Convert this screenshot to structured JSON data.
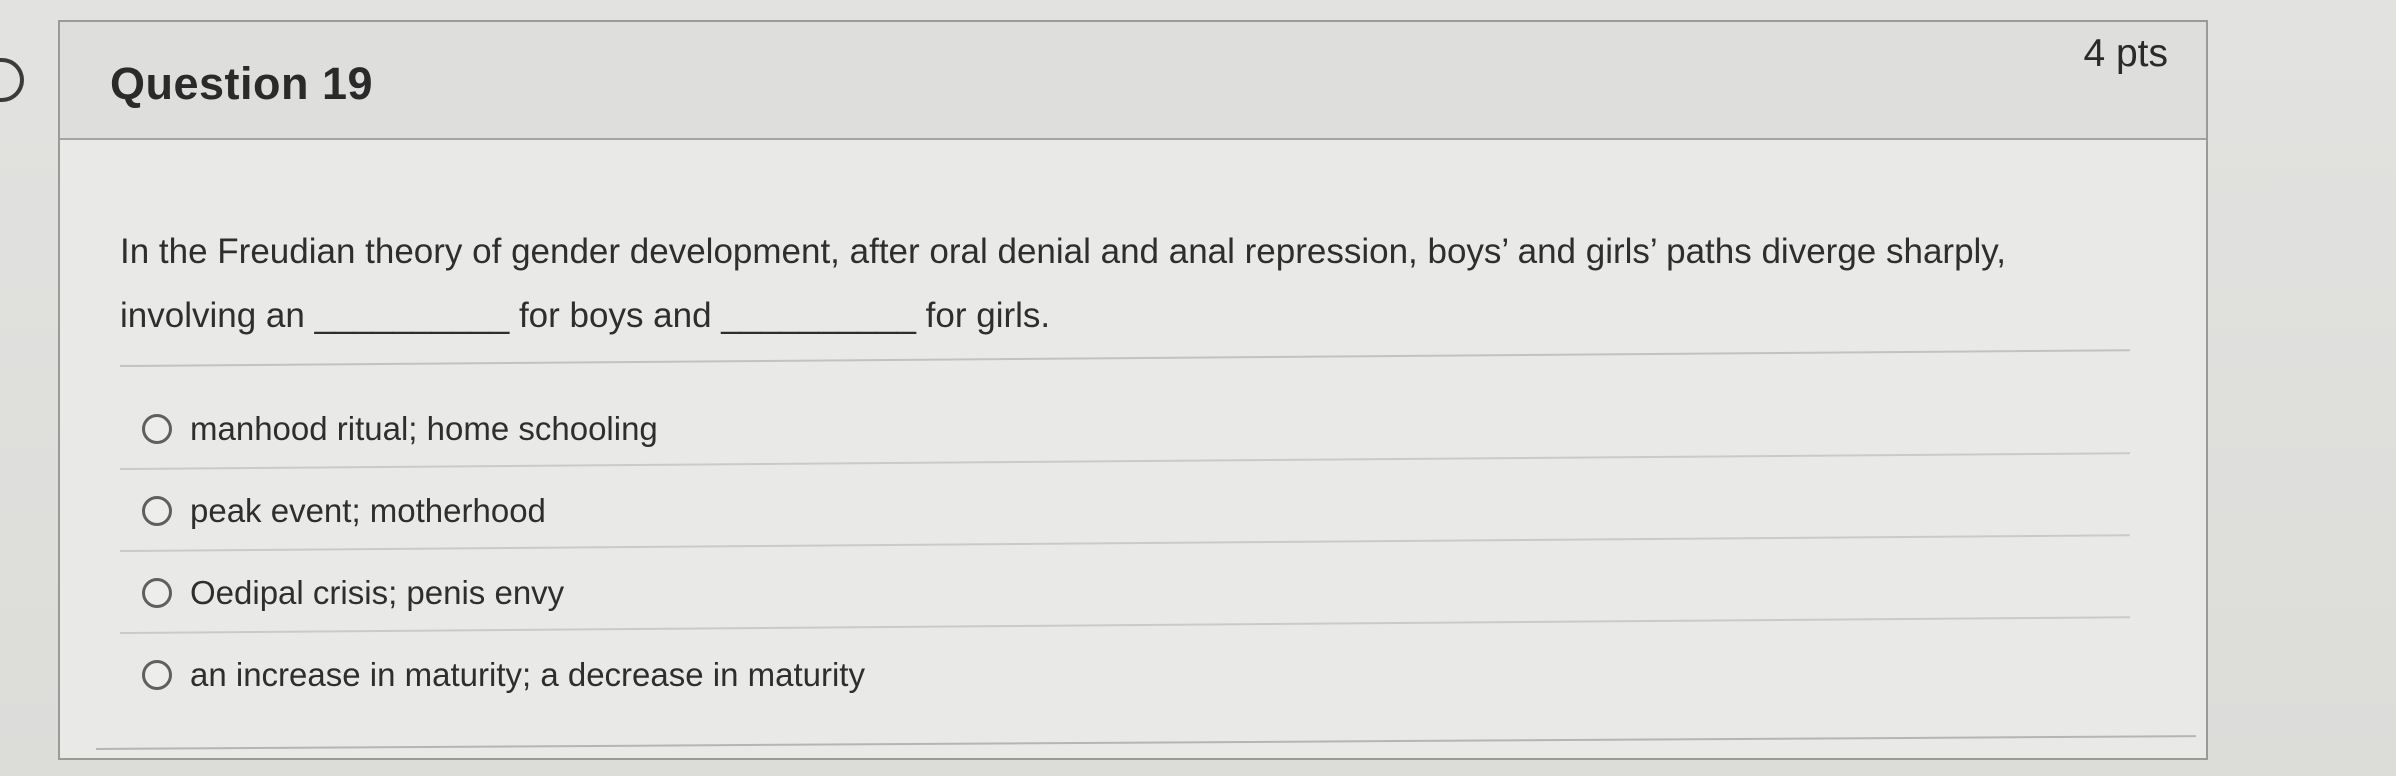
{
  "question": {
    "title": "Question 19",
    "points": "4 pts",
    "text": "In the Freudian theory of gender development, after oral denial and anal repression, boys’ and girls’ paths diverge sharply, involving an __________ for boys and __________ for girls.",
    "options": [
      {
        "label": "manhood ritual; home schooling"
      },
      {
        "label": "peak event; motherhood"
      },
      {
        "label": "Oedipal crisis; penis envy"
      },
      {
        "label": "an increase in maturity; a decrease in maturity"
      }
    ]
  }
}
